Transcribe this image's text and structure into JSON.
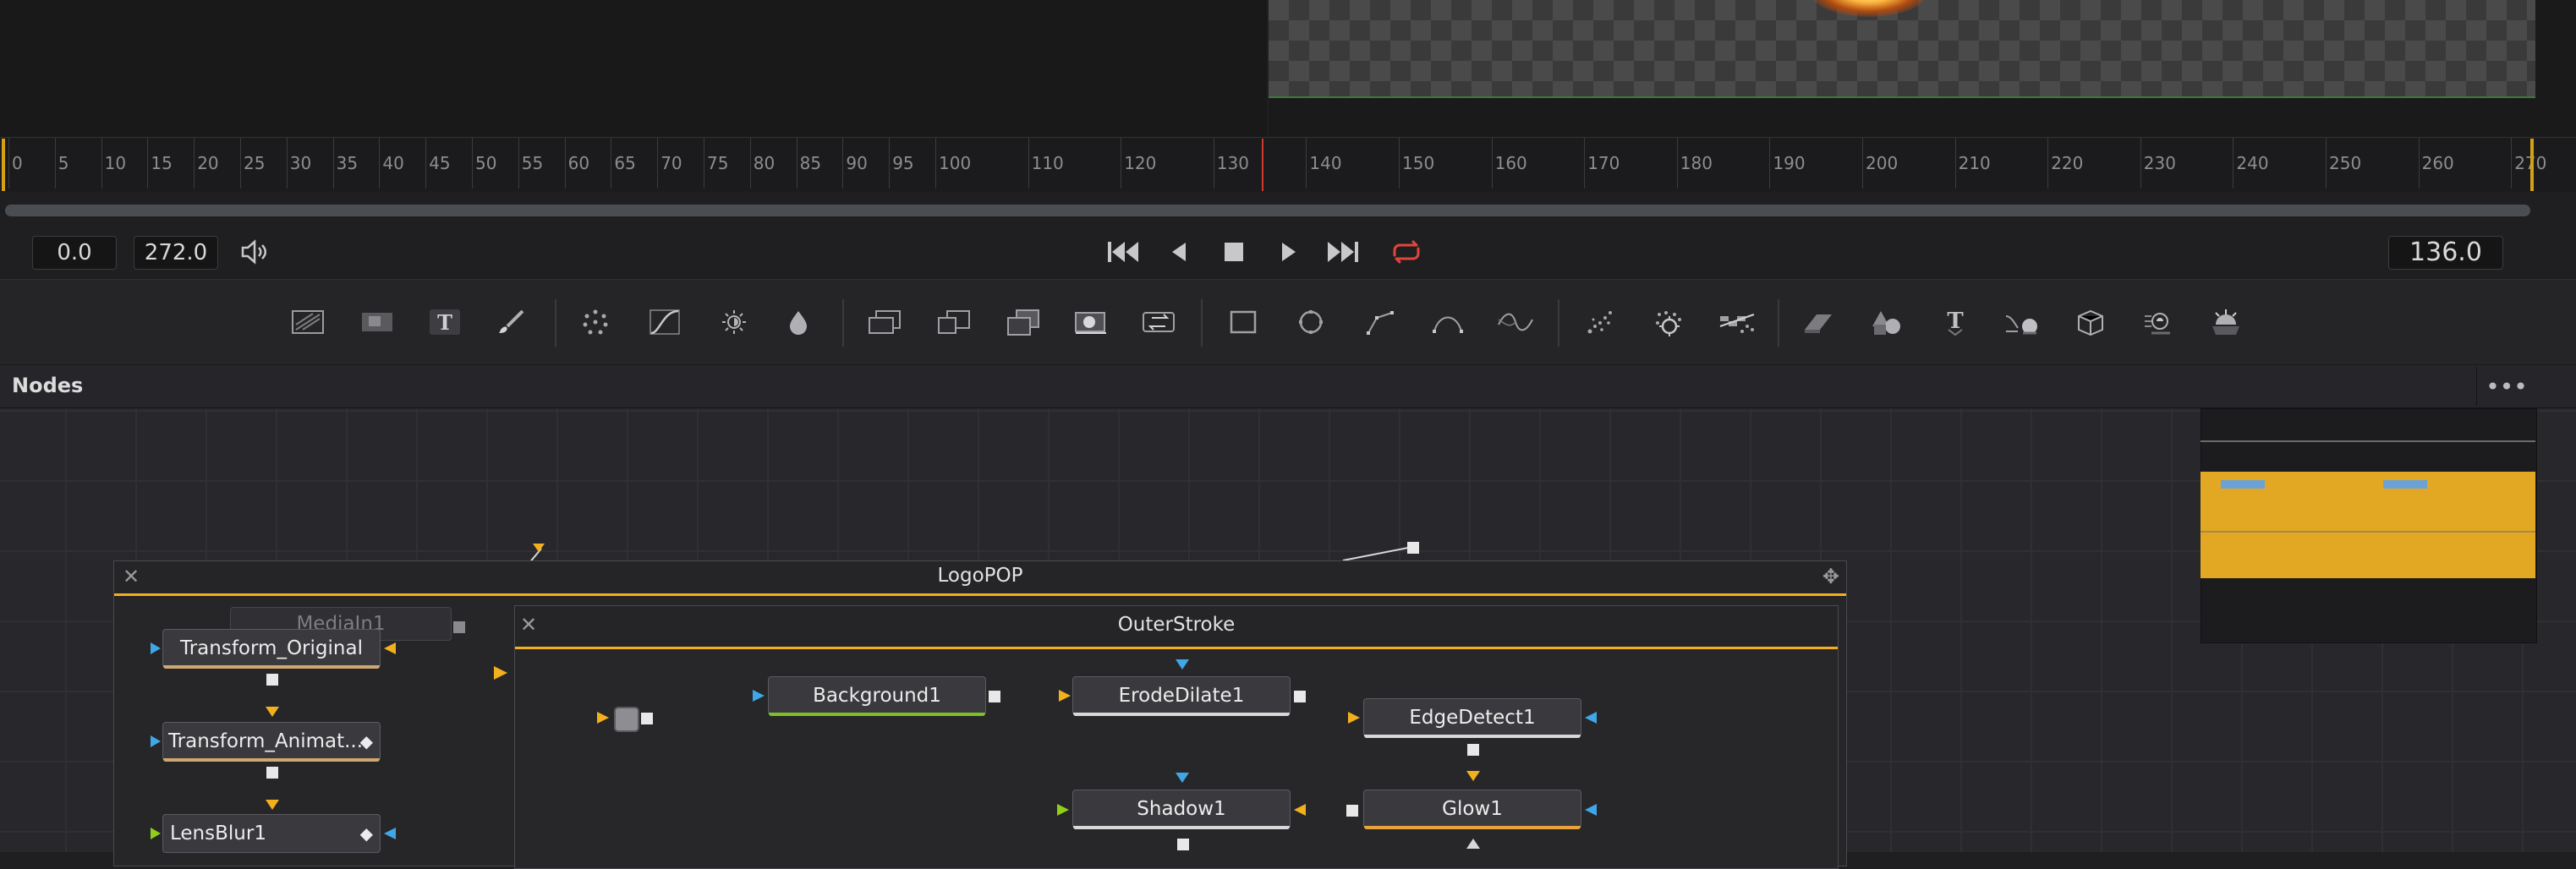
{
  "ruler": {
    "labels": [
      "0",
      "5",
      "10",
      "15",
      "20",
      "25",
      "30",
      "35",
      "40",
      "45",
      "50",
      "55",
      "60",
      "65",
      "70",
      "75",
      "80",
      "85",
      "90",
      "95",
      "100",
      "110",
      "120",
      "130",
      "140",
      "150",
      "160",
      "170",
      "180",
      "190",
      "200",
      "210",
      "220",
      "230",
      "240",
      "250",
      "260",
      "270"
    ]
  },
  "transport": {
    "start_time": "0.0",
    "end_time": "272.0",
    "current_time": "136.0"
  },
  "nodes_panel": {
    "title": "Nodes",
    "options_label": "•••"
  },
  "groups": {
    "logopop": {
      "title": "LogoPOP"
    },
    "outerstroke": {
      "title": "OuterStroke"
    }
  },
  "nodes": {
    "mediain": "MediaIn1",
    "transform_original": "Transform_Original",
    "transform_animat": "Transform_Animat...",
    "lensblur": "LensBlur1",
    "background": "Background1",
    "erodedilate": "ErodeDilate1",
    "edgedetect": "EdgeDetect1",
    "shadow": "Shadow1",
    "glow": "Glow1"
  },
  "colors": {
    "accent_orange": "#f2b01e",
    "playhead_red": "#d0382e",
    "link_green": "#8fcf1a"
  }
}
